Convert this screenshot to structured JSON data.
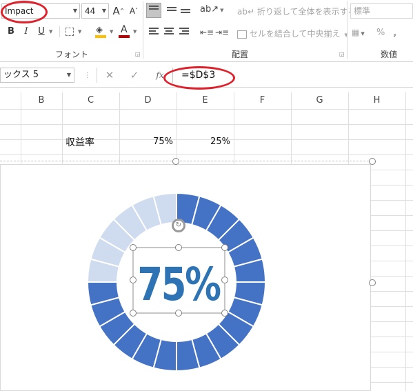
{
  "ribbon": {
    "font_name": "Impact",
    "font_size": "44",
    "grow_font": "A",
    "shrink_font": "A",
    "bold": "B",
    "italic": "I",
    "underline": "U",
    "font_color_glyph": "A",
    "font_group_label": "フォント",
    "wrap_text": "折り返して全体を表示する",
    "merge_center": "セルを結合して中央揃え",
    "alignment_group_label": "配置",
    "number_format": "標準",
    "percent": "%",
    "comma": ",",
    "number_group_label": "数値",
    "font_color": "#c00000",
    "fill_color": "#ffc000"
  },
  "formula_bar": {
    "name_box": "ックス 5",
    "cancel": "✕",
    "enter": "✓",
    "fx": "fx",
    "formula": "=$D$3"
  },
  "grid": {
    "columns": [
      "B",
      "C",
      "D",
      "E",
      "F",
      "G",
      "H"
    ],
    "cells": {
      "c3": "収益率",
      "d3": "75%",
      "e3": "25%"
    }
  },
  "chart": {
    "label": "75%",
    "filled_fraction": 0.75,
    "segments": 24,
    "filled_color": "#4472c4",
    "empty_color": "#cfdcef",
    "label_color": "#2e74b5"
  },
  "annotation": {
    "color": "#e0202a"
  }
}
